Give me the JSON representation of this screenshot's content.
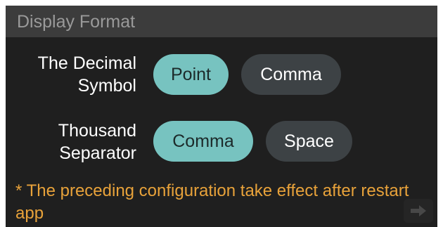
{
  "header": {
    "title": "Display Format"
  },
  "decimal_symbol": {
    "label_line1": "The Decimal",
    "label_line2": "Symbol",
    "options": [
      {
        "label": "Point",
        "selected": true
      },
      {
        "label": "Comma",
        "selected": false
      }
    ]
  },
  "thousand_separator": {
    "label_line1": "Thousand",
    "label_line2": "Separator",
    "options": [
      {
        "label": "Comma",
        "selected": true
      },
      {
        "label": "Space",
        "selected": false
      }
    ]
  },
  "note": {
    "text": "* The preceding configuration take effect after restart app"
  },
  "colors": {
    "panel_bg": "#1f1f1f",
    "header_bg": "#3c3c3c",
    "selected_pill": "#77c3c0",
    "unselected_pill": "#3d4245",
    "note_text": "#e8a23a"
  },
  "icons": {
    "corner": "arrow-right-icon"
  }
}
